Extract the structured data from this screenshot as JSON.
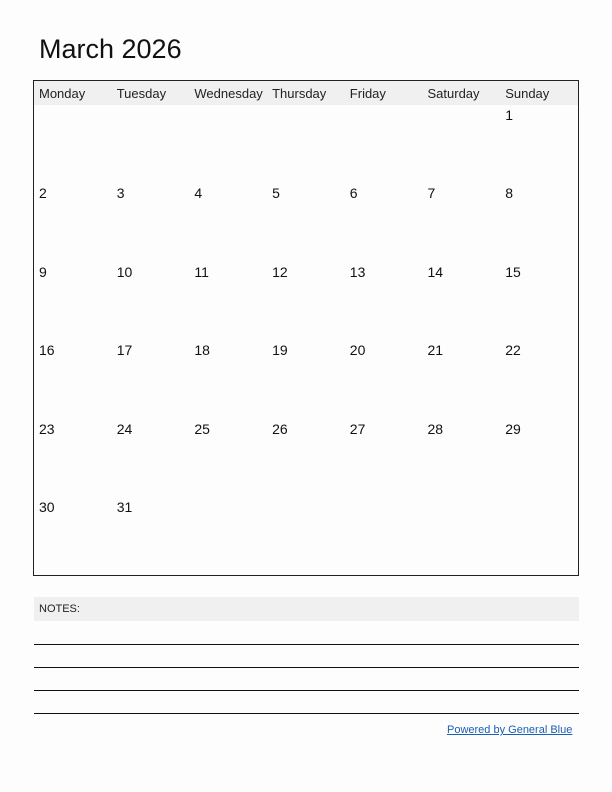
{
  "title": "March 2026",
  "weekdays": [
    "Monday",
    "Tuesday",
    "Wednesday",
    "Thursday",
    "Friday",
    "Saturday",
    "Sunday"
  ],
  "weeks": [
    [
      "",
      "",
      "",
      "",
      "",
      "",
      "1"
    ],
    [
      "2",
      "3",
      "4",
      "5",
      "6",
      "7",
      "8"
    ],
    [
      "9",
      "10",
      "11",
      "12",
      "13",
      "14",
      "15"
    ],
    [
      "16",
      "17",
      "18",
      "19",
      "20",
      "21",
      "22"
    ],
    [
      "23",
      "24",
      "25",
      "26",
      "27",
      "28",
      "29"
    ],
    [
      "30",
      "31",
      "",
      "",
      "",
      "",
      ""
    ]
  ],
  "notes": {
    "label": "NOTES:",
    "line_count": 4
  },
  "footer": {
    "powered_by": "Powered by General Blue",
    "link_color": "#1a5fb4"
  }
}
